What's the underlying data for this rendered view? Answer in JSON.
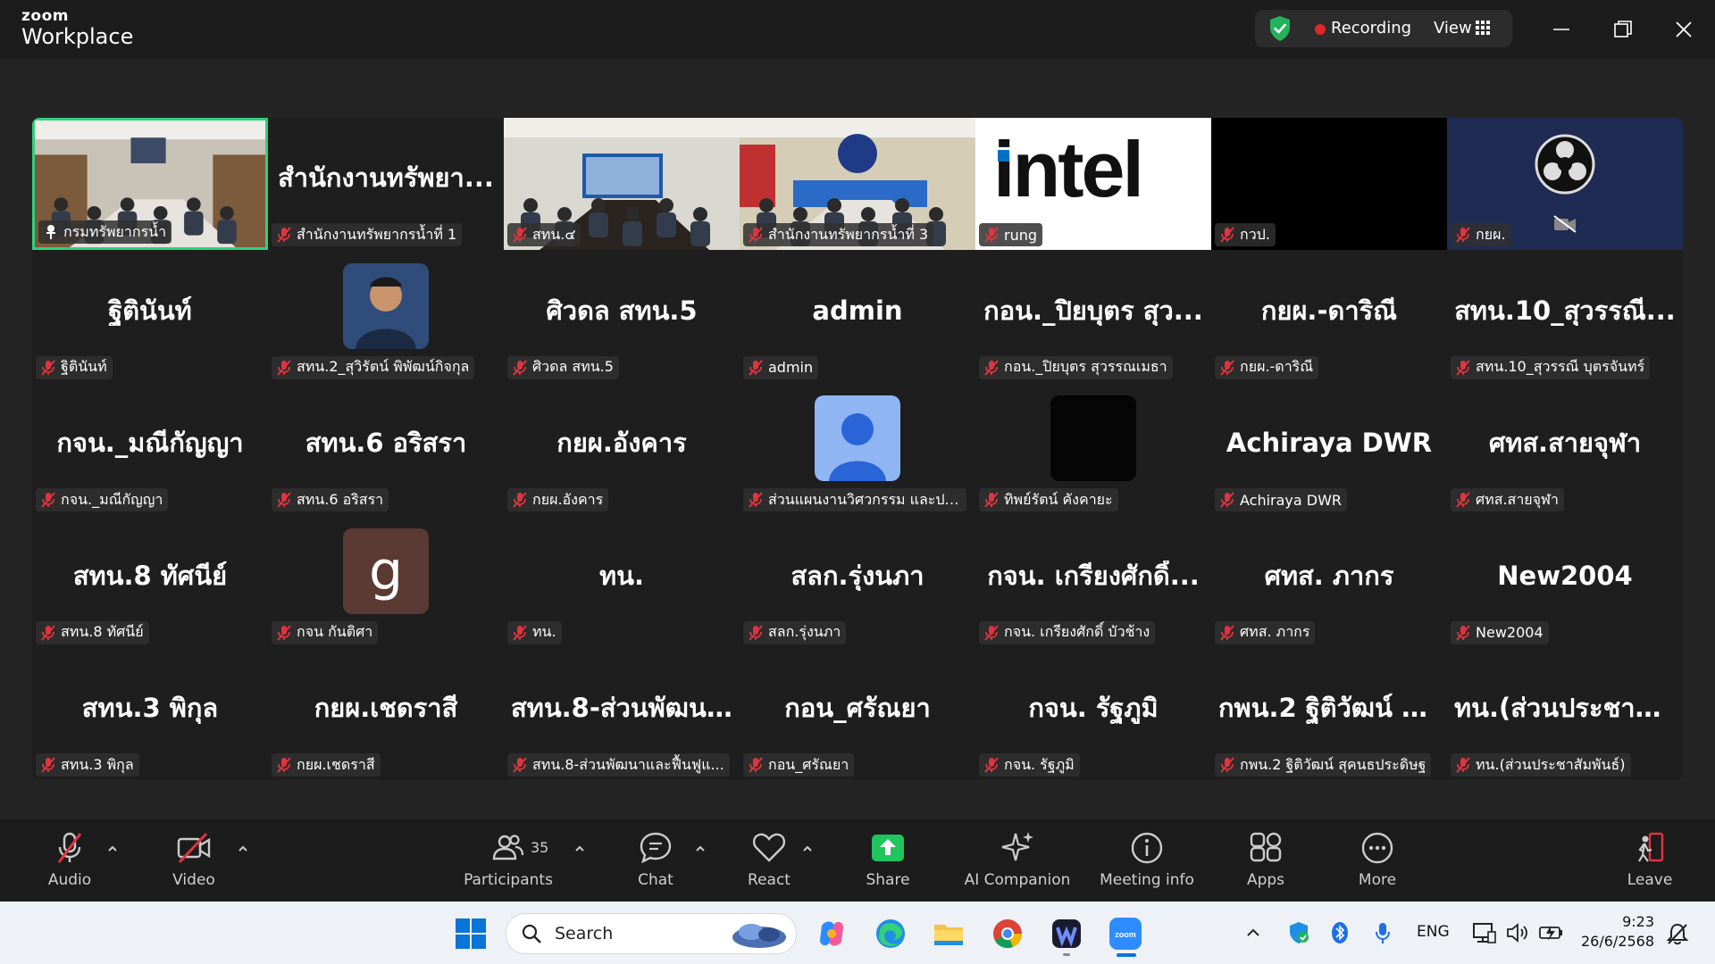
{
  "titlebar": {
    "brand_small": "zoom",
    "brand_big": "Workplace",
    "recording": "Recording",
    "view": "View"
  },
  "colors": {
    "active_speaker_border": "#2fd17a",
    "muted_icon": "#e0343f",
    "recording_dot": "#e02828",
    "share_green": "#21c55d"
  },
  "tiles": [
    {
      "display": "",
      "label": "กรมทรัพยากรน้ำ",
      "type": "video-room1",
      "active": true
    },
    {
      "display": "สำนักงานทรัพยา...",
      "label": "สำนักงานทรัพยากรน้ำที่ 1",
      "type": "text"
    },
    {
      "display": "",
      "label": "สทน.๔",
      "type": "video-room2"
    },
    {
      "display": "",
      "label": "สำนักงานทรัพยากรน้ำที่ 3",
      "type": "video-room3"
    },
    {
      "display": "intel",
      "label": "rung",
      "type": "intel"
    },
    {
      "display": "",
      "label": "กวป.",
      "type": "black"
    },
    {
      "display": "",
      "label": "กยผ.",
      "type": "obs"
    },
    {
      "display": "ฐิตินันท์",
      "label": "ฐิตินันท์",
      "type": "text"
    },
    {
      "display": "",
      "label": "สทน.2_สุวิรัตน์ พิพัฒน์กิจกุล",
      "type": "photo"
    },
    {
      "display": "ศิวดล สทน.5",
      "label": "ศิวดล สทน.5",
      "type": "text"
    },
    {
      "display": "admin",
      "label": "admin",
      "type": "text"
    },
    {
      "display": "กอน._ปิยบุตร สุว...",
      "label": "กอน._ปิยบุตร สุวรรณเมธา",
      "type": "text"
    },
    {
      "display": "กยผ.-ดาริณี",
      "label": "กยผ.-ดาริณี",
      "type": "text"
    },
    {
      "display": "สทน.10_สุวรรณี...",
      "label": "สทน.10_สุวรรณี บุตรจันทร์",
      "type": "text"
    },
    {
      "display": "กจน._มณีกัญญา",
      "label": "กจน._มณีกัญญา",
      "type": "text"
    },
    {
      "display": "สทน.6 อริสรา",
      "label": "สทน.6 อริสรา",
      "type": "text"
    },
    {
      "display": "กยผ.อังคาร",
      "label": "กยผ.อังคาร",
      "type": "text"
    },
    {
      "display": "",
      "label": "ส่วนแผนงานวิศวกรรม และประ...",
      "type": "default-avatar"
    },
    {
      "display": "",
      "label": "ทิพย์รัตน์ คังคายะ",
      "type": "dark-avatar"
    },
    {
      "display": "Achiraya DWR",
      "label": "Achiraya DWR",
      "type": "text"
    },
    {
      "display": "ศทส.สายจุฬา",
      "label": "ศทส.สายจุฬา",
      "type": "text"
    },
    {
      "display": "สทน.8 ทัศนีย์",
      "label": "สทน.8 ทัศนีย์",
      "type": "text"
    },
    {
      "display": "g",
      "label": "กจน กันติศา",
      "type": "letter-avatar"
    },
    {
      "display": "ทน.",
      "label": "ทน.",
      "type": "text"
    },
    {
      "display": "สลก.รุ่งนภา",
      "label": "สลก.รุ่งนภา",
      "type": "text"
    },
    {
      "display": "กจน. เกรียงศักดิ์...",
      "label": "กจน. เกรียงศักดิ์ บัวช้าง",
      "type": "text"
    },
    {
      "display": "ศทส. ภากร",
      "label": "ศทส. ภากร",
      "type": "text"
    },
    {
      "display": "New2004",
      "label": "New2004",
      "type": "text"
    },
    {
      "display": "สทน.3 พิกุล",
      "label": "สทน.3 พิกุล",
      "type": "text"
    },
    {
      "display": "กยผ.เชดราสี",
      "label": "กยผ.เชดราสี",
      "type": "text"
    },
    {
      "display": "สทน.8-ส่วนพัฒน...",
      "label": "สทน.8-ส่วนพัฒนาและฟื้นฟูแ...",
      "type": "text"
    },
    {
      "display": "กอน_ศรัณยา",
      "label": "กอน_ศรัณยา",
      "type": "text"
    },
    {
      "display": "กจน. รัฐภูมิ",
      "label": "กจน. รัฐภูมิ",
      "type": "text"
    },
    {
      "display": "กพน.2 ฐิติวัฒน์ สุ...",
      "label": "กพน.2 ฐิติวัฒน์ สุคนธประดิษฐ",
      "type": "text"
    },
    {
      "display": "ทน.(ส่วนประชาสั...",
      "label": "ทน.(ส่วนประชาสัมพันธ์)",
      "type": "text"
    }
  ],
  "toolbar": {
    "audio": "Audio",
    "video": "Video",
    "participants": "Participants",
    "participant_count": "35",
    "chat": "Chat",
    "react": "React",
    "share": "Share",
    "ai_companion": "AI Companion",
    "meeting_info": "Meeting info",
    "apps": "Apps",
    "more": "More",
    "leave": "Leave"
  },
  "taskbar": {
    "search": "Search",
    "language": "ENG",
    "time": "9:23",
    "date": "26/6/2568"
  }
}
